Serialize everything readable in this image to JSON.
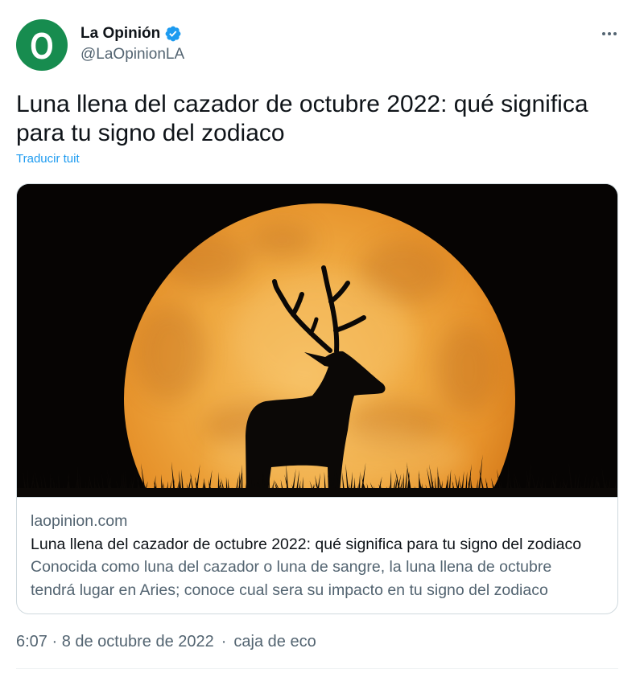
{
  "colors": {
    "accent": "#1d9bf0",
    "text_primary": "#0f1419",
    "text_secondary": "#536471",
    "border": "#cfd9de",
    "divider": "#eff3f4",
    "avatar_bg": "#178c4f"
  },
  "author": {
    "name": "La Opinión",
    "handle": "@LaOpinionLA",
    "avatar_logo_text": "O",
    "verified_icon": "verified-badge-icon"
  },
  "more_icon": "more-icon",
  "tweet": {
    "text": "Luna llena del cazador de octubre 2022: qué significa para tu signo del zodiaco",
    "translate_label": "Traducir tuit"
  },
  "card": {
    "domain": "laopinion.com",
    "title": "Luna llena del cazador de octubre 2022: qué significa para tu signo del zodiaco",
    "description": "Conocida como luna del cazador o luna de sangre, la luna llena de octubre tendrá lugar en Aries; conoce cual sera su impacto en tu signo del zodiaco"
  },
  "footer": {
    "timestamp": "6:07 · 8 de octubre de 2022",
    "separator": "·",
    "source": "caja de eco"
  }
}
